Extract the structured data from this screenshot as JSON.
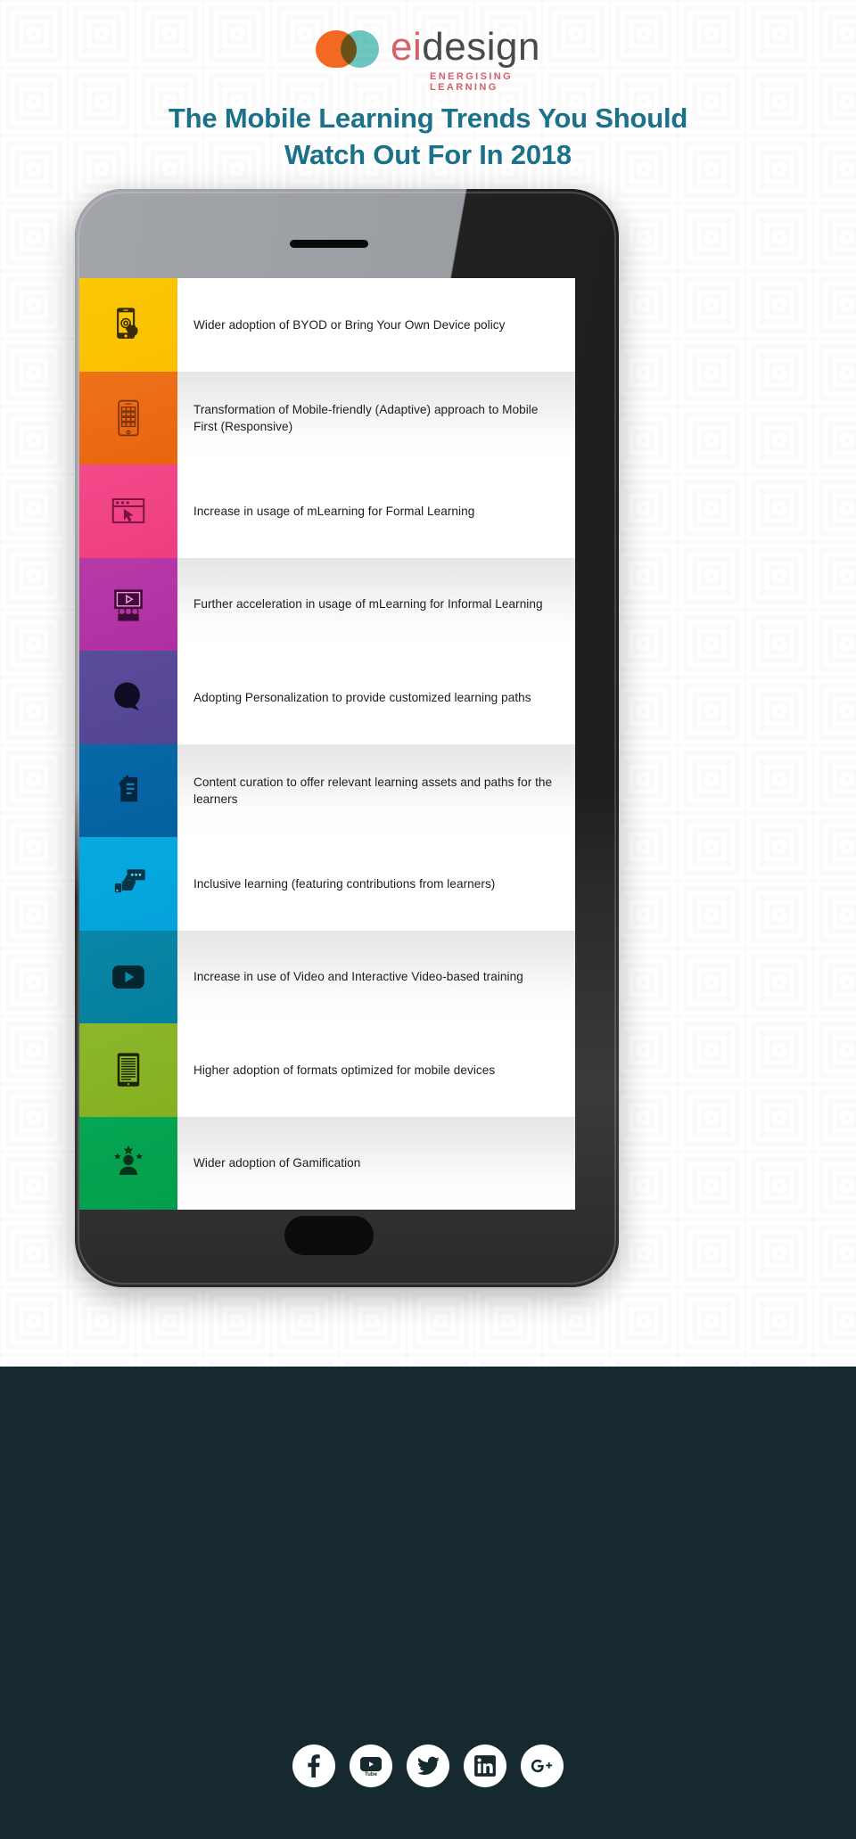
{
  "brand": {
    "logo_word_ei": "ei",
    "logo_word_design": "design",
    "tagline": "ENERGISING LEARNING",
    "accent_orange": "#f26a21",
    "accent_teal": "#6ec6c0",
    "accent_pink": "#d4606a"
  },
  "header": {
    "title_line1": "The Mobile Learning Trends You Should",
    "title_line2": "Watch Out For In 2018",
    "title_color": "#1b7189"
  },
  "phone": {
    "bezel_color": "#1c1c1c",
    "sheen_color": "#9a9da2",
    "speaker_label": "earpiece-speaker",
    "home_button_label": "home-button"
  },
  "trends": [
    {
      "index": 1,
      "text": "Wider adoption of BYOD or Bring Your Own Device policy",
      "color": "#fbc707",
      "color_to": "#f9c000",
      "icon": "smartphone-touch-icon"
    },
    {
      "index": 2,
      "text": "Transformation of Mobile-friendly (Adaptive) approach to Mobile First (Responsive)",
      "color": "#ee7219",
      "color_to": "#e8650f",
      "icon": "tablet-app-grid-icon"
    },
    {
      "index": 3,
      "text": "Increase in usage of mLearning for Formal Learning",
      "color": "#f24a8a",
      "color_to": "#ef3d7f",
      "icon": "browser-window-cursor-icon"
    },
    {
      "index": 4,
      "text": "Further acceleration in usage of mLearning for Informal Learning",
      "color": "#b73aa8",
      "color_to": "#b02fa2",
      "icon": "presentation-audience-icon"
    },
    {
      "index": 5,
      "text": "Adopting Personalization to provide customized learning paths",
      "color": "#5b4b9b",
      "color_to": "#544593",
      "icon": "speech-bubble-icon"
    },
    {
      "index": 6,
      "text": "Content curation to offer relevant learning assets and paths for the learners",
      "color": "#0868a8",
      "color_to": "#0461a0",
      "icon": "documents-stack-icon"
    },
    {
      "index": 7,
      "text": "Inclusive learning (featuring contributions from learners)",
      "color": "#08a9e0",
      "color_to": "#03a2db",
      "icon": "thumbs-up-chat-icon"
    },
    {
      "index": 8,
      "text": "Increase in use of Video and Interactive Video-based training",
      "color": "#0a86a8",
      "color_to": "#057f9f",
      "icon": "video-play-icon"
    },
    {
      "index": 9,
      "text": "Higher adoption of formats optimized for mobile devices",
      "color": "#8cb72c",
      "color_to": "#84b021",
      "icon": "ereader-document-icon"
    },
    {
      "index": 10,
      "text": "Wider adoption of Gamification",
      "color": "#06a653",
      "color_to": "#029e4c",
      "icon": "gamification-badge-icon"
    }
  ],
  "footer": {
    "band_color": "#15292f",
    "social_links": [
      {
        "name": "facebook",
        "label": "Facebook"
      },
      {
        "name": "youtube",
        "label": "YouTube"
      },
      {
        "name": "twitter",
        "label": "Twitter"
      },
      {
        "name": "linkedin",
        "label": "LinkedIn"
      },
      {
        "name": "googleplus",
        "label": "Google Plus"
      }
    ]
  }
}
